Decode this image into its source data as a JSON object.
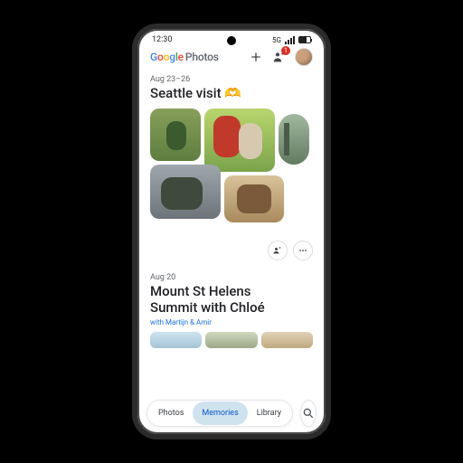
{
  "status": {
    "time": "12:30",
    "network": "5G"
  },
  "appbar": {
    "brand": "Google",
    "app": "Photos",
    "share_badge": "1"
  },
  "memory1": {
    "date": "Aug 23–26",
    "title": "Seattle visit 🫶"
  },
  "memory2": {
    "date": "Aug 20",
    "title_line1": "Mount St Helens",
    "title_line2": "Summit with Chloé",
    "with": "with Martijn & Amir"
  },
  "nav": {
    "photos": "Photos",
    "memories": "Memories",
    "library": "Library"
  }
}
